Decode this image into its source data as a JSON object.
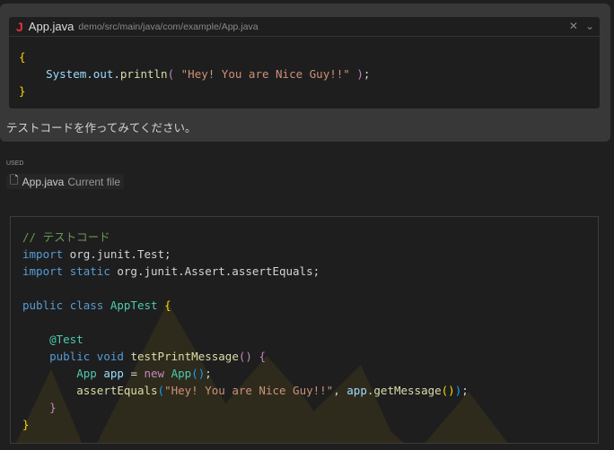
{
  "reference": {
    "icon": "java-icon",
    "file": "App.java",
    "path": "demo/src/main/java/com/example/App.java",
    "close": "✕",
    "expand": "⌄",
    "code": {
      "l1": "{",
      "l2a": "    System",
      "l2b": ".out.",
      "l2c": "println",
      "l2d": "( ",
      "l2e": "\"Hey! You are Nice Guy!!\"",
      "l2f": " )",
      ";": ";",
      "l3": "}"
    }
  },
  "message": "テストコードを作ってみてください。",
  "used": {
    "label": "USED",
    "file": "App.java",
    "desc": "Current file"
  },
  "code_block": {
    "comment": "// テストコード",
    "import": "import",
    "static": "static",
    "pkg1": " org.junit.Test;",
    "pkg2": " org.junit.Assert.assertEquals;",
    "public": "public",
    "class": "class",
    "cls": "AppTest",
    "annotation": "@Test",
    "void": "void",
    "method": "testPrintMessage",
    "App": "App",
    "app": "app",
    "new": "new",
    "assert": "assertEquals",
    "str": "\"Hey! You are Nice Guy!!\"",
    "getMessage": "getMessage"
  }
}
